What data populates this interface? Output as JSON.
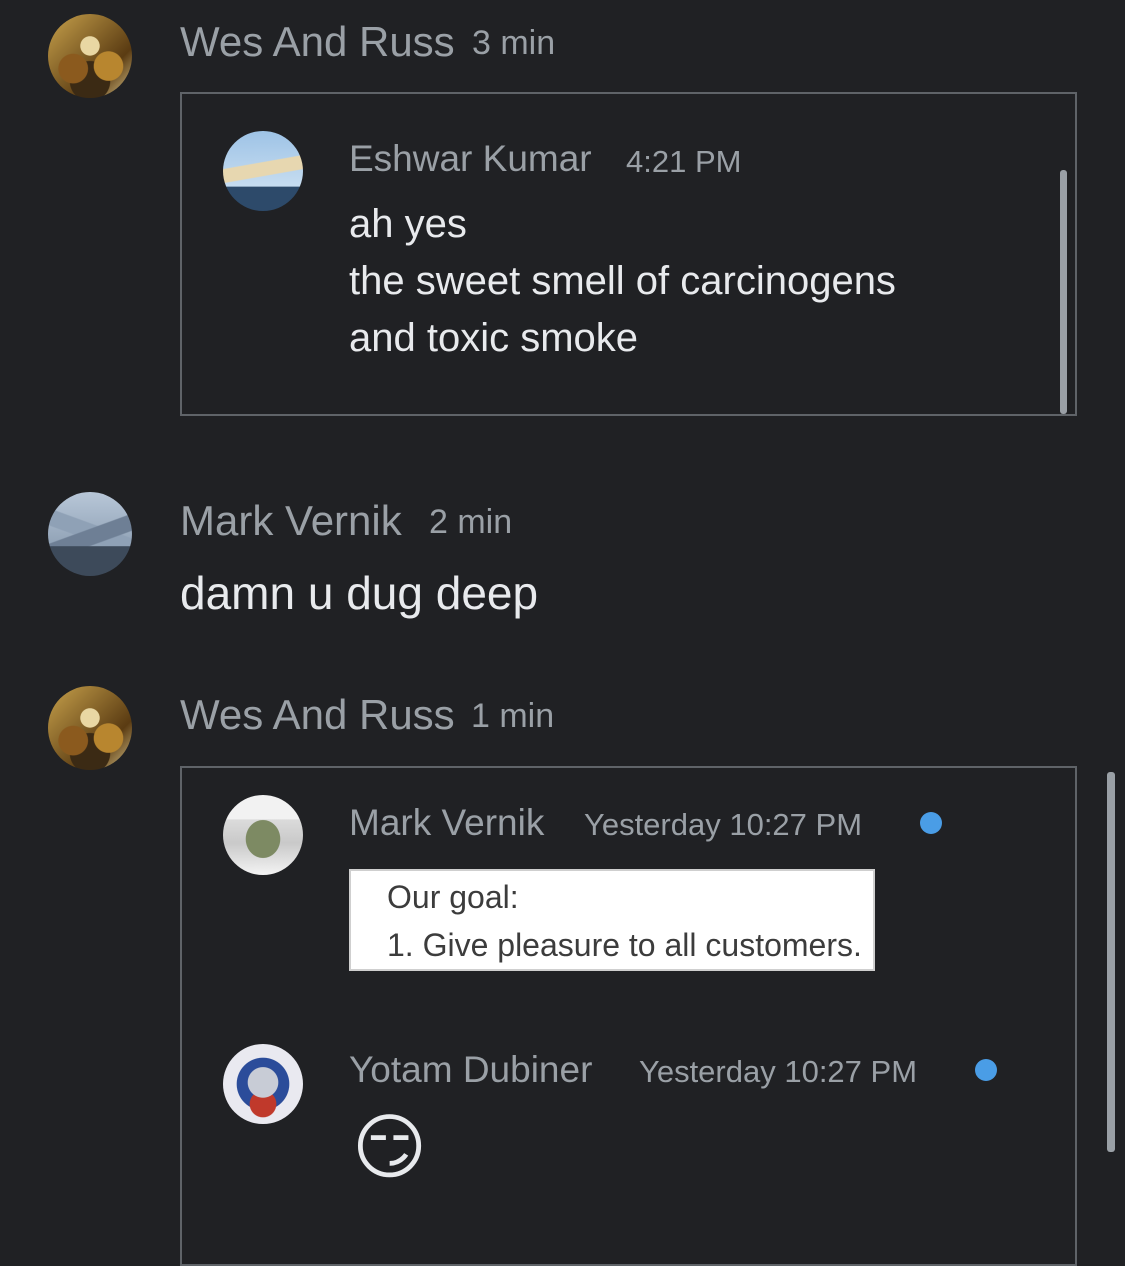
{
  "messages": [
    {
      "author": "Wes And Russ",
      "time": "3 min",
      "quote": {
        "author": "Eshwar Kumar",
        "time": "4:21 PM",
        "lines": [
          "ah yes",
          "the sweet smell of carcinogens",
          "and toxic smoke"
        ]
      }
    },
    {
      "author": "Mark Vernik",
      "time": "2 min",
      "text": "damn u dug deep"
    },
    {
      "author": "Wes And Russ",
      "time": "1 min",
      "quote": {
        "first": {
          "author": "Mark Vernik",
          "time": "Yesterday 10:27 PM",
          "image_lines": [
            "Our goal:",
            "1. Give pleasure to all customers."
          ]
        },
        "second": {
          "author": "Yotam Dubiner",
          "time": "Yesterday 10:27 PM",
          "emoji": "😏"
        }
      }
    }
  ],
  "colors": {
    "background": "#202124",
    "meta_text": "#9aa0a6",
    "body_text": "#e8eaed",
    "unread_dot": "#4a9de6"
  }
}
